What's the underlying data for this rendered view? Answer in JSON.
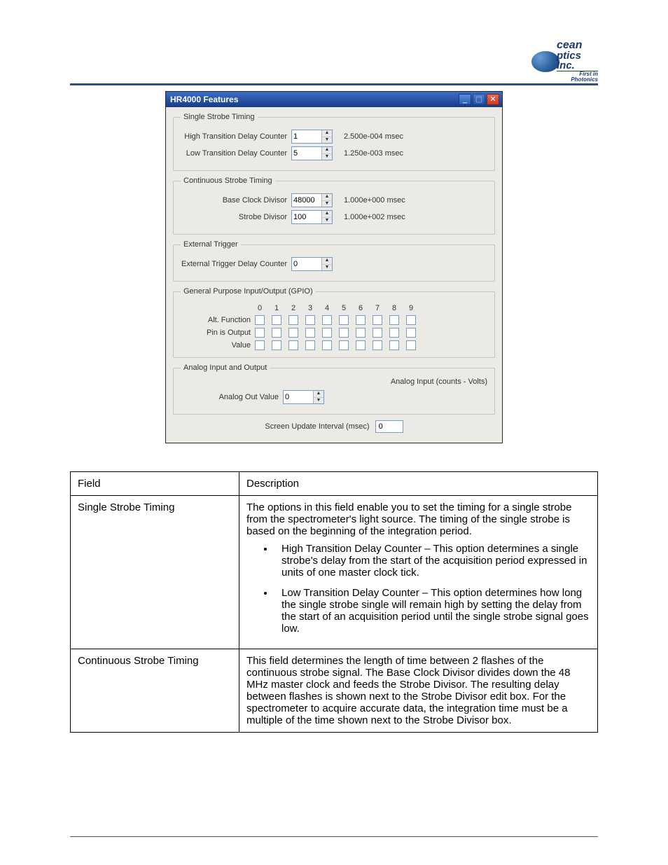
{
  "logo": {
    "line1": "cean",
    "line2": "ptics Inc.",
    "tag": "First in Photonics"
  },
  "dialog": {
    "title": "HR4000 Features",
    "window_buttons": {
      "min": "_",
      "max": "▢",
      "close": "✕"
    },
    "single_strobe": {
      "legend": "Single Strobe Timing",
      "high_label": "High Transition Delay Counter",
      "high_value": "1",
      "high_readout": "2.500e-004 msec",
      "low_label": "Low Transition Delay Counter",
      "low_value": "5",
      "low_readout": "1.250e-003 msec"
    },
    "continuous_strobe": {
      "legend": "Continuous Strobe Timing",
      "base_label": "Base Clock Divisor",
      "base_value": "48000",
      "base_readout": "1.000e+000 msec",
      "strobe_label": "Strobe Divisor",
      "strobe_value": "100",
      "strobe_readout": "1.000e+002 msec"
    },
    "external_trigger": {
      "legend": "External Trigger",
      "label": "External Trigger Delay Counter",
      "value": "0"
    },
    "gpio": {
      "legend": "General Purpose Input/Output (GPIO)",
      "cols": [
        "0",
        "1",
        "2",
        "3",
        "4",
        "5",
        "6",
        "7",
        "8",
        "9"
      ],
      "rows": [
        {
          "label": "Alt. Function",
          "values": [
            false,
            false,
            false,
            false,
            false,
            false,
            false,
            false,
            false,
            false
          ]
        },
        {
          "label": "Pin is Output",
          "values": [
            false,
            false,
            false,
            false,
            false,
            false,
            false,
            false,
            false,
            false
          ]
        },
        {
          "label": "Value",
          "values": [
            false,
            false,
            false,
            false,
            false,
            false,
            false,
            false,
            false,
            false
          ]
        }
      ]
    },
    "analog": {
      "legend": "Analog Input and Output",
      "right_text": "Analog Input (counts - Volts)",
      "out_label": "Analog Out Value",
      "out_value": "0"
    },
    "update": {
      "label": "Screen Update Interval (msec)",
      "value": "0"
    }
  },
  "table": {
    "header_field": "Field",
    "header_desc": "Description",
    "row1_field": "Single Strobe Timing",
    "row1_intro": "The options in this field enable you to set the timing for a single strobe from the spectrometer's light source. The timing of the single strobe is based on the beginning of the integration period.",
    "row1_b1_term": "High Transition Delay Counter",
    "row1_b1_rest": " – This option determines a single strobe's delay from the start of the acquisition period expressed in units of one master clock tick.",
    "row1_b2_term": "Low Transition Delay Counter",
    "row1_b2_rest": " – This option determines how long the single strobe single will remain high by setting the delay from the start of an acquisition period until the single strobe signal goes low.",
    "row2_field": "Continuous Strobe Timing",
    "row2_p1a": "This field determines the length of time between 2 flashes of the continuous strobe signal. The ",
    "row2_t1": "Base Clock Divisor",
    "row2_p1b": " divides down the 48 MHz master clock and feeds the ",
    "row2_t2": "Strobe Divisor",
    "row2_p1c": ". The resulting delay between flashes is shown next to the ",
    "row2_t3": "Strobe Divisor",
    "row2_p1d": " edit box. For the spectrometer to acquire accurate data, the integration time must be a multiple of the time shown next to the ",
    "row2_t4": "Strobe Divisor",
    "row2_p1e": " box."
  }
}
